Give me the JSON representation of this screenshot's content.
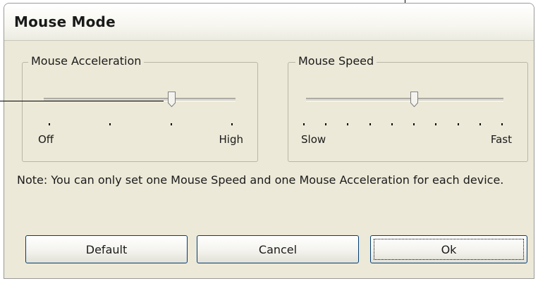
{
  "dialog": {
    "title": "Mouse Mode"
  },
  "acceleration": {
    "legend": "Mouse Acceleration",
    "min_label": "Off",
    "max_label": "High",
    "tick_count": 4,
    "value_index": 2
  },
  "speed": {
    "legend": "Mouse Speed",
    "min_label": "Slow",
    "max_label": "Fast",
    "tick_count": 10,
    "value_index": 5
  },
  "note": "Note: You can only set one Mouse Speed and one Mouse Acceleration for each device.",
  "buttons": {
    "default": "Default",
    "cancel": "Cancel",
    "ok": "Ok"
  }
}
